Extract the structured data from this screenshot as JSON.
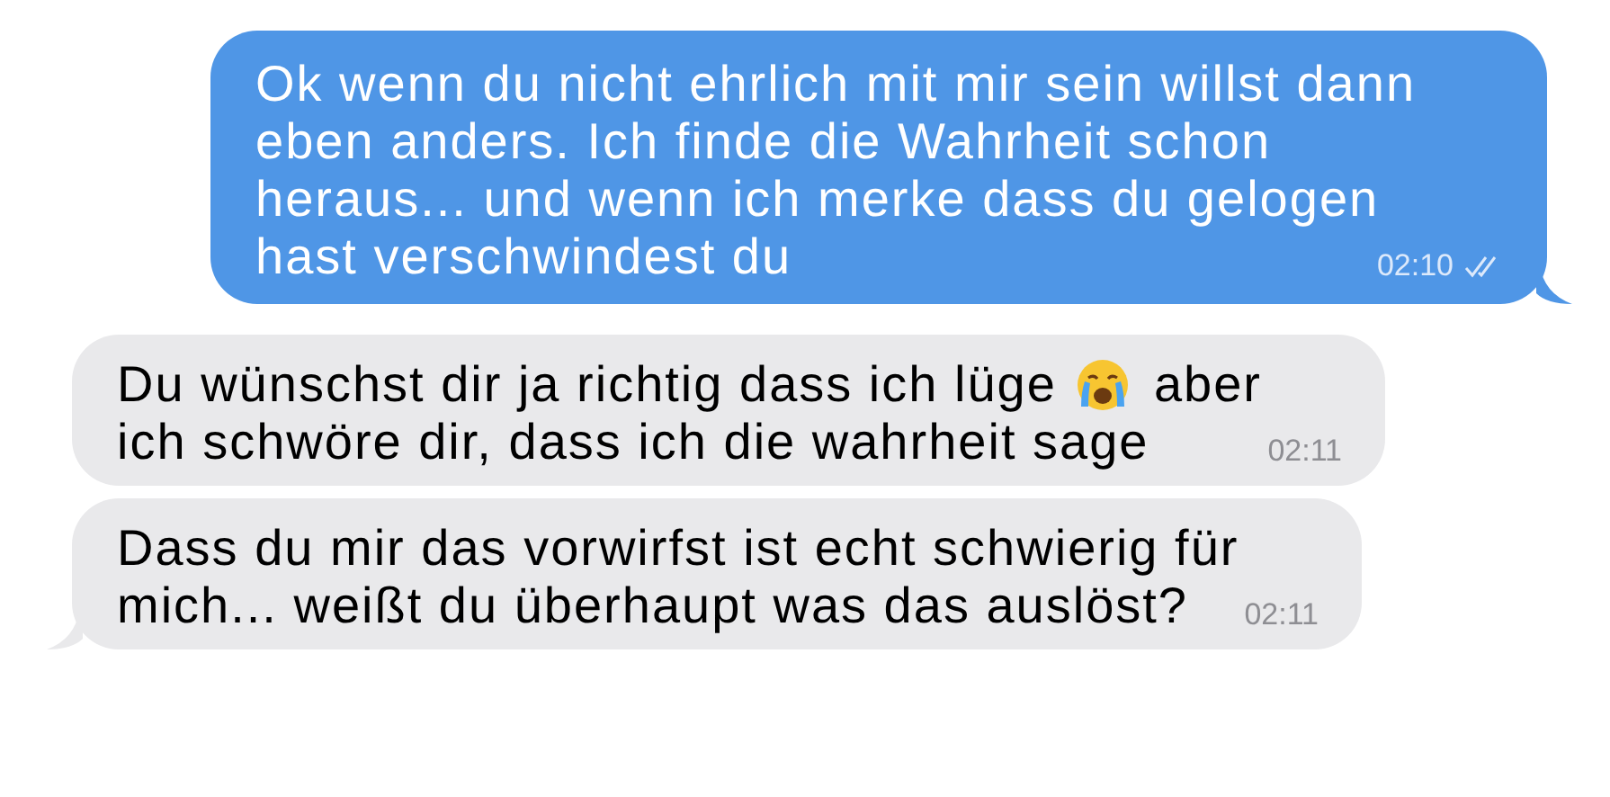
{
  "messages": [
    {
      "kind": "outgoing",
      "lines": [
        [
          {
            "kind": "text",
            "text": "Ok wenn du nicht ehrlich mit mir sein willst dann"
          }
        ],
        [
          {
            "kind": "text",
            "text": "eben anders. Ich finde die Wahrheit schon"
          }
        ],
        [
          {
            "kind": "text",
            "text": "heraus... und wenn ich merke dass du gelogen"
          }
        ],
        [
          {
            "kind": "text",
            "text": "hast verschwindest du"
          }
        ]
      ],
      "time": "02:10",
      "read": true,
      "tail": true
    },
    {
      "kind": "incoming",
      "lines": [
        [
          {
            "kind": "text",
            "text": "Du wünschst dir ja richtig dass ich lüge"
          },
          {
            "kind": "emoji"
          },
          {
            "kind": "text",
            "text": "aber"
          }
        ],
        [
          {
            "kind": "text",
            "text": "ich schwöre dir, dass ich die wahrheit sage"
          }
        ]
      ],
      "time": "02:11",
      "tail": false
    },
    {
      "kind": "incoming",
      "lines": [
        [
          {
            "kind": "text",
            "text": "Dass du mir das vorwirfst ist echt schwierig für"
          }
        ],
        [
          {
            "kind": "text",
            "text": "mich... weißt du überhaupt was das auslöst?"
          }
        ]
      ],
      "time": "02:11",
      "tail": true
    }
  ]
}
